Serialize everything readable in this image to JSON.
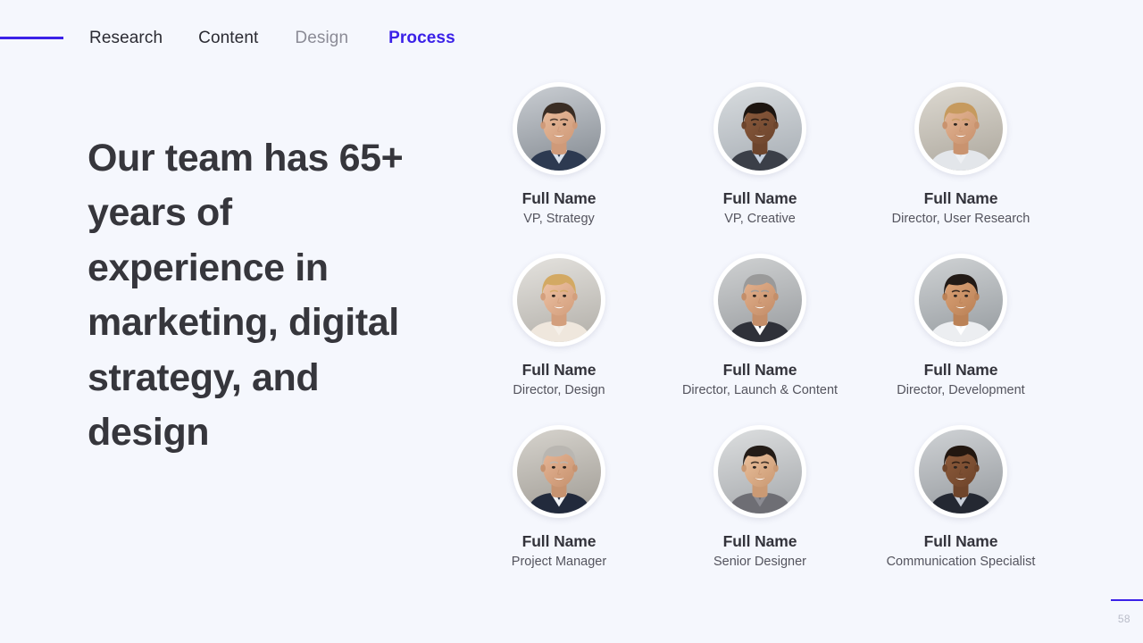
{
  "nav": {
    "rule": "accent-rule",
    "items": [
      {
        "label": "Research",
        "state": "default"
      },
      {
        "label": "Content",
        "state": "default"
      },
      {
        "label": "Design",
        "state": "dim"
      },
      {
        "label": "Process",
        "state": "active"
      }
    ]
  },
  "headline": {
    "text": "Our team has 65+ years of experience in marketing, digital strategy, and design"
  },
  "team": {
    "members": [
      {
        "name": "Full Name",
        "role": "VP, Strategy",
        "avatar": {
          "skin": "#e8bb9b",
          "skin_shadow": "#cf9a79",
          "hair": "#3a2d24",
          "clothing": "#2d3a51",
          "shirt": "#d9e1ec",
          "bg_top": "#c9cdd2",
          "bg_bottom": "#8e949b"
        }
      },
      {
        "name": "Full Name",
        "role": "VP, Creative",
        "avatar": {
          "skin": "#8a5a3c",
          "skin_shadow": "#6d452d",
          "hair": "#1d1510",
          "clothing": "#3b3f48",
          "shirt": "#c3cedd",
          "bg_top": "#d8dcdf",
          "bg_bottom": "#aeb4ba"
        }
      },
      {
        "name": "Full Name",
        "role": "Director, User Research",
        "avatar": {
          "skin": "#e4b594",
          "skin_shadow": "#c9936f",
          "hair": "#c69a5e",
          "clothing": "#e3e6ea",
          "shirt": "#eef0f3",
          "bg_top": "#ddd9d1",
          "bg_bottom": "#b3aea4"
        }
      },
      {
        "name": "Full Name",
        "role": "Director, Design",
        "avatar": {
          "skin": "#eec2a4",
          "skin_shadow": "#d39f7d",
          "hair": "#d3a963",
          "clothing": "#efe7dd",
          "shirt": "#f5f0e9",
          "bg_top": "#e4e2de",
          "bg_bottom": "#b9b6b0"
        }
      },
      {
        "name": "Full Name",
        "role": "Director, Launch & Content",
        "avatar": {
          "skin": "#e3b08c",
          "skin_shadow": "#c48e69",
          "hair": "#9a9a9a",
          "clothing": "#2f3139",
          "shirt": "#ffffff",
          "bg_top": "#cfd1d2",
          "bg_bottom": "#a0a3a6"
        }
      },
      {
        "name": "Full Name",
        "role": "Director, Development",
        "avatar": {
          "skin": "#dba276",
          "skin_shadow": "#bb8257",
          "hair": "#221a16",
          "clothing": "#eceef1",
          "shirt": "#ffffff",
          "bg_top": "#cfd2d4",
          "bg_bottom": "#9ea3a7"
        }
      },
      {
        "name": "Full Name",
        "role": "Project Manager",
        "avatar": {
          "skin": "#e6b595",
          "skin_shadow": "#c79370",
          "hair": "#b9b6b1",
          "clothing": "#222a3c",
          "shirt": "#f2f4f7",
          "bg_top": "#d6d3cd",
          "bg_bottom": "#a8a49d"
        }
      },
      {
        "name": "Full Name",
        "role": "Senior Designer",
        "avatar": {
          "skin": "#eac09c",
          "skin_shadow": "#cb9a74",
          "hair": "#241c17",
          "clothing": "#6e6e74",
          "shirt": "#8c8c93",
          "bg_top": "#dcdedf",
          "bg_bottom": "#adb0b3"
        }
      },
      {
        "name": "Full Name",
        "role": "Communication Specialist",
        "avatar": {
          "skin": "#8d5b3b",
          "skin_shadow": "#6f452b",
          "hair": "#221710",
          "clothing": "#242832",
          "shirt": "#c8ced8",
          "bg_top": "#cfd2d5",
          "bg_bottom": "#9ea2a6"
        }
      }
    ]
  },
  "footer": {
    "page_number": "58"
  },
  "colors": {
    "background": "#f5f7fd",
    "accent": "#3b21e8",
    "heading": "#36363c",
    "nav_default": "#2b2b33",
    "nav_dim": "#8b8b96",
    "name": "#33333b",
    "role": "#54545e",
    "page_number": "#b9bcc8"
  }
}
